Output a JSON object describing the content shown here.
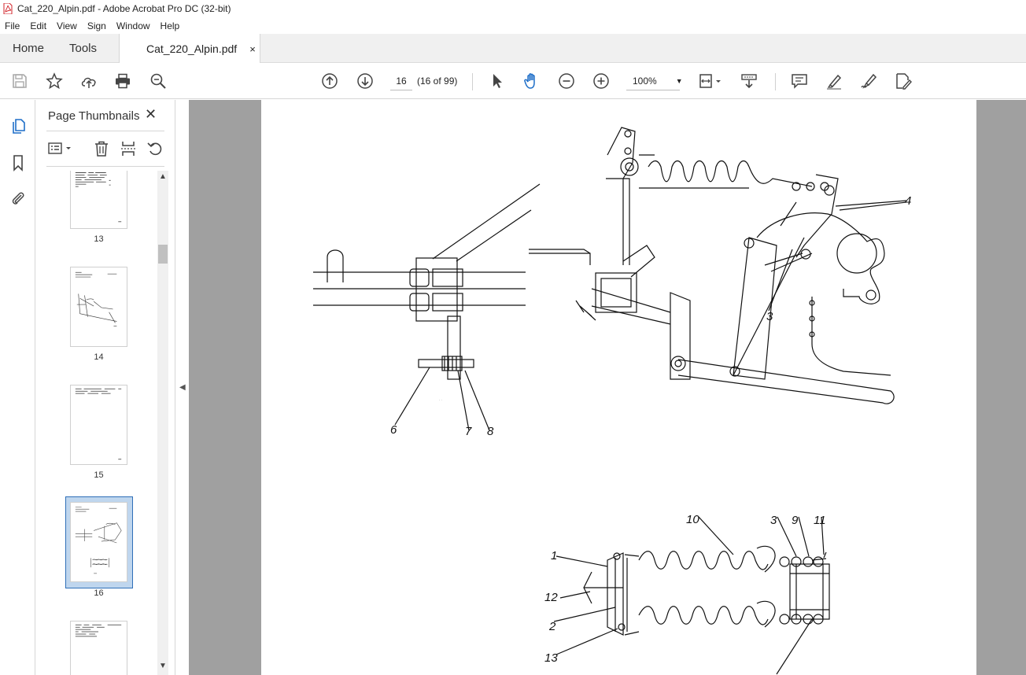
{
  "window": {
    "title": "Cat_220_Alpin.pdf - Adobe Acrobat Pro DC (32-bit)"
  },
  "menu": [
    "File",
    "Edit",
    "View",
    "Sign",
    "Window",
    "Help"
  ],
  "tabs": {
    "home": "Home",
    "tools": "Tools",
    "document": "Cat_220_Alpin.pdf",
    "close": "×"
  },
  "toolbar": {
    "page_number": "16",
    "page_count": "(16 of 99)",
    "zoom": "100%"
  },
  "panel": {
    "title": "Page Thumbnails",
    "close": "✕",
    "thumbnails": [
      {
        "label": "13",
        "selected": false
      },
      {
        "label": "14",
        "selected": false
      },
      {
        "label": "15",
        "selected": false
      },
      {
        "label": "16",
        "selected": true
      },
      {
        "label": "",
        "selected": false
      }
    ]
  },
  "drawing_upper": {
    "callouts": [
      "6",
      "7",
      "8",
      "3",
      "4"
    ]
  },
  "drawing_lower": {
    "callouts": [
      "10",
      "3",
      "9",
      "11",
      "1",
      "12",
      "2",
      "13"
    ]
  },
  "colors": {
    "accent": "#1f6fc8",
    "selection": "#bfd6ee",
    "doc_background": "#a0a0a0"
  }
}
